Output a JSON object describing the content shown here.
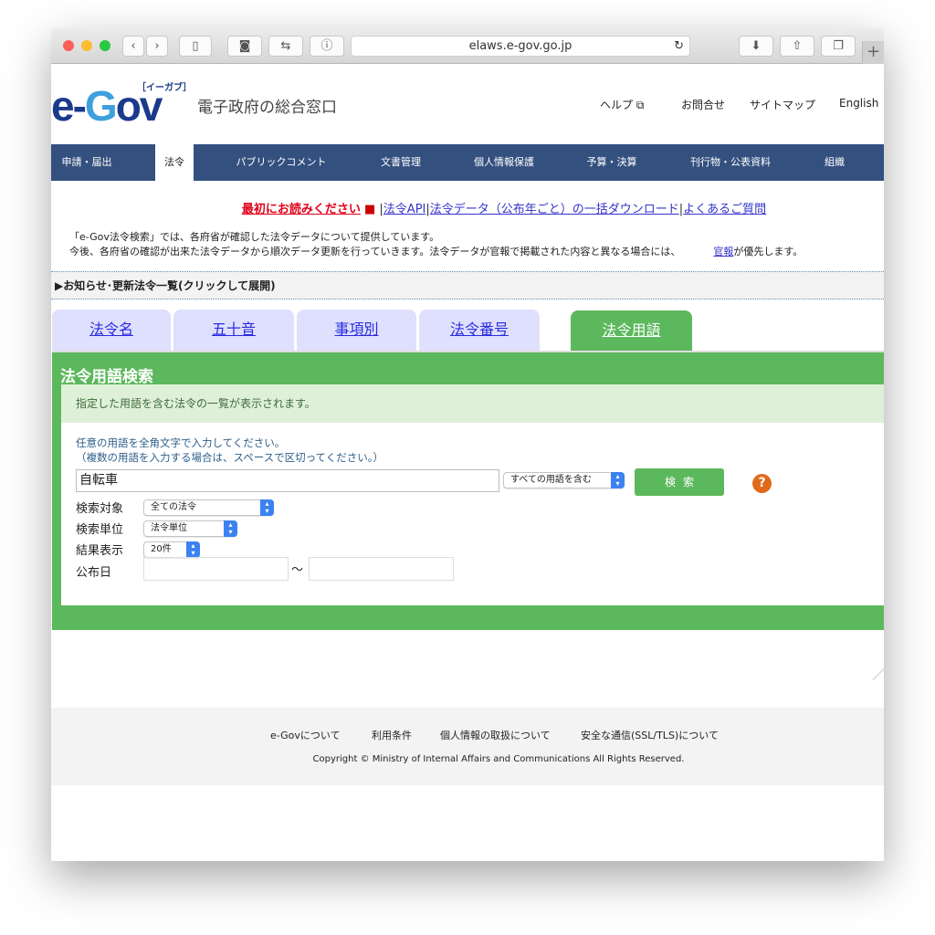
{
  "browser": {
    "url": "elaws.e-gov.go.jp"
  },
  "header": {
    "logo": "e-Gov",
    "logo_kana": "［イーガブ］",
    "site_title": "電子政府の総合窓口",
    "links": [
      "ヘルプ",
      "お問合せ",
      "サイトマップ",
      "English"
    ]
  },
  "nav": [
    "申請・届出",
    "法令",
    "パブリックコメント",
    "文書管理",
    "個人情報保護",
    "予算・決算",
    "刊行物・公表資料",
    "組織"
  ],
  "top_links": {
    "read_first": "最初にお読みください",
    "api": "法令API",
    "download": "法令データ（公布年ごと）の一括ダウンロード",
    "faq": "よくあるご質問",
    "sep": "|"
  },
  "notice": {
    "line1": "「e-Gov法令検索」では、各府省が確認した法令データについて提供しています。",
    "line2": "今後、各府省の確認が出来た法令データから順次データ更新を行っていきます。法令データが官報で掲載された内容と異なる場合には、",
    "kanpo": "官報",
    "line2_end": "が優先します。"
  },
  "news": "▶お知らせ･更新法令一覧(クリックして展開)",
  "tabs": [
    "法令名",
    "五十音",
    "事項別",
    "法令番号",
    "法令用語"
  ],
  "panel": {
    "title": "法令用語検索",
    "description": "指定した用語を含む法令の一覧が表示されます。",
    "hint1": "任意の用語を全角文字で入力してください。",
    "hint2": "（複数の用語を入力する場合は、スペースで区切ってください。）",
    "term": "自転車",
    "match_mode": "すべての用語を含む",
    "search": "検索",
    "help": "?",
    "target_label": "検索対象",
    "target": "全ての法令",
    "unit_label": "検索単位",
    "unit": "法令単位",
    "results_label": "結果表示",
    "results": "20件",
    "date_label": "公布日",
    "date_sep": "〜"
  },
  "footer": {
    "links": [
      "e-Govについて",
      "利用条件",
      "個人情報の取扱について",
      "安全な通信(SSL/TLS)について"
    ],
    "copyright": "Copyright © Ministry of Internal Affairs and Communications All Rights Reserved."
  }
}
